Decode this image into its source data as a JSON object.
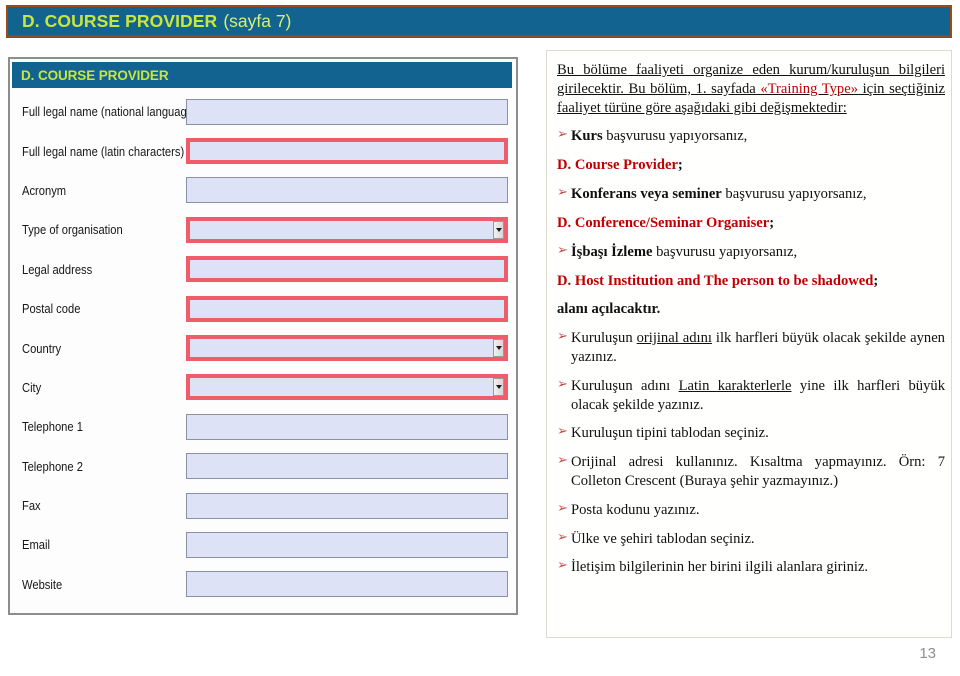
{
  "slide": {
    "title_bold": "D. COURSE PROVIDER",
    "title_light": "(sayfa 7)",
    "page_number": "13"
  },
  "colors": {
    "banner_background": "#12638f",
    "banner_text": "#c8e63c",
    "banner_border": "#9a4b16",
    "field_fill": "#dde2f7",
    "field_border_gray": "#8b90a3",
    "field_border_red": "#ef5d6a",
    "accent_red": "#c00000",
    "bullet_red": "#c0504d"
  },
  "form_panel": {
    "header": "D. COURSE PROVIDER",
    "fields": [
      {
        "label": "Full legal name (national language)",
        "border": "gray",
        "dropdown": false
      },
      {
        "label": "Full legal name (latin characters)",
        "border": "red",
        "dropdown": false
      },
      {
        "label": "Acronym",
        "border": "gray",
        "dropdown": false
      },
      {
        "label": "Type of organisation",
        "border": "red",
        "dropdown": true
      },
      {
        "label": "Legal address",
        "border": "red",
        "dropdown": false
      },
      {
        "label": "Postal code",
        "border": "red",
        "dropdown": false
      },
      {
        "label": "Country",
        "border": "red",
        "dropdown": true
      },
      {
        "label": "City",
        "border": "red",
        "dropdown": true
      },
      {
        "label": "Telephone 1",
        "border": "gray",
        "dropdown": false
      },
      {
        "label": "Telephone 2",
        "border": "gray",
        "dropdown": false
      },
      {
        "label": "Fax",
        "border": "gray",
        "dropdown": false
      },
      {
        "label": "Email",
        "border": "gray",
        "dropdown": false
      },
      {
        "label": "Website",
        "border": "gray",
        "dropdown": false
      }
    ]
  },
  "text_panel": {
    "intro": {
      "part1": "Bu bölüme faaliyeti organize eden kurum/kuruluşun bilgileri girilecektir. Bu bölüm, 1. sayfada ",
      "highlight": "«Training Type»",
      "part2": " için seçtiğiniz faaliyet türüne göre aşağıdaki gibi değişmektedir:"
    },
    "items": [
      {
        "kind": "bullet",
        "bold": "Kurs",
        "rest": " başvurusu yapıyorsanız,"
      },
      {
        "kind": "heading",
        "red": "D. Course Provider",
        "rest": ";"
      },
      {
        "kind": "bullet",
        "bold": "Konferans veya seminer",
        "rest": " başvurusu yapıyorsanız,"
      },
      {
        "kind": "heading",
        "red": "D. Conference/Seminar Organiser",
        "rest": ";"
      },
      {
        "kind": "bullet",
        "bold": "İşbaşı İzleme",
        "rest": " başvurusu yapıyorsanız,"
      },
      {
        "kind": "heading",
        "red": "D. Host Institution and The person to be shadowed",
        "rest": ";"
      },
      {
        "kind": "plainbold",
        "text": "alanı açılacaktır."
      },
      {
        "kind": "bullet_u",
        "pre": "Kuruluşun ",
        "underline": "orijinal adını",
        "post": " ilk harfleri büyük olacak şekilde aynen yazınız."
      },
      {
        "kind": "bullet_u",
        "pre": "Kuruluşun adını ",
        "underline": "Latin karakterlerle",
        "post": " yine ilk harfleri büyük olacak şekilde yazınız."
      },
      {
        "kind": "plain",
        "text": "Kuruluşun tipini tablodan seçiniz."
      },
      {
        "kind": "plain",
        "text": "Orijinal adresi kullanınız. Kısaltma yapmayınız. Örn: 7 Colleton Crescent (Buraya şehir yazmayınız.)"
      },
      {
        "kind": "plain",
        "text": "Posta kodunu yazınız."
      },
      {
        "kind": "plain",
        "text": "Ülke ve şehiri tablodan seçiniz."
      },
      {
        "kind": "plain",
        "text": "İletişim bilgilerinin her birini ilgili alanlara giriniz."
      }
    ]
  }
}
